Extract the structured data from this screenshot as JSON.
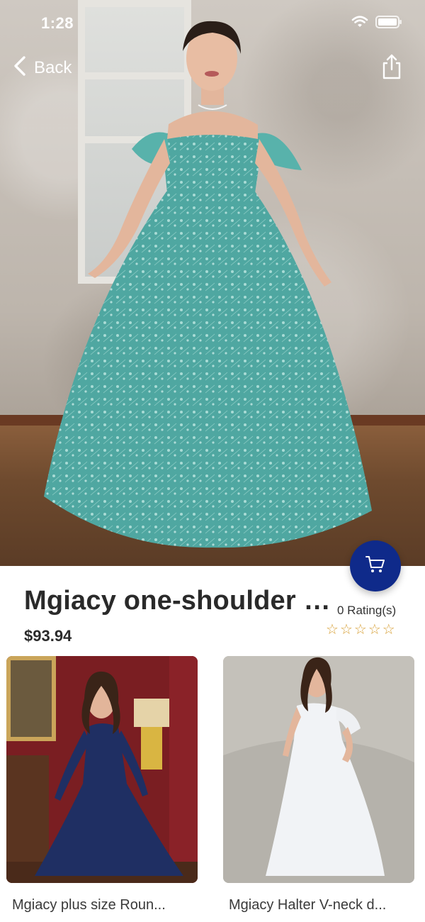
{
  "status_bar": {
    "time": "1:28",
    "icons": [
      "wifi-icon",
      "battery-icon"
    ]
  },
  "nav": {
    "back_label": "Back",
    "back_icon": "chevron-left-icon",
    "share_icon": "share-icon"
  },
  "product": {
    "title": "Mgiacy one-shoulder l...",
    "price": "$93.94",
    "rating_count": "0 Rating(s)",
    "stars": [
      "☆",
      "☆",
      "☆",
      "☆",
      "☆"
    ],
    "dress_color": "#4fa7a1"
  },
  "cart_fab": {
    "icon": "cart-icon",
    "color": "#0f2a8a"
  },
  "related": [
    {
      "caption": "Mgiacy plus size Roun...",
      "dress_color": "#1f2f63"
    },
    {
      "caption": "Mgiacy Halter V-neck d...",
      "dress_color": "#f1f3f6"
    }
  ]
}
